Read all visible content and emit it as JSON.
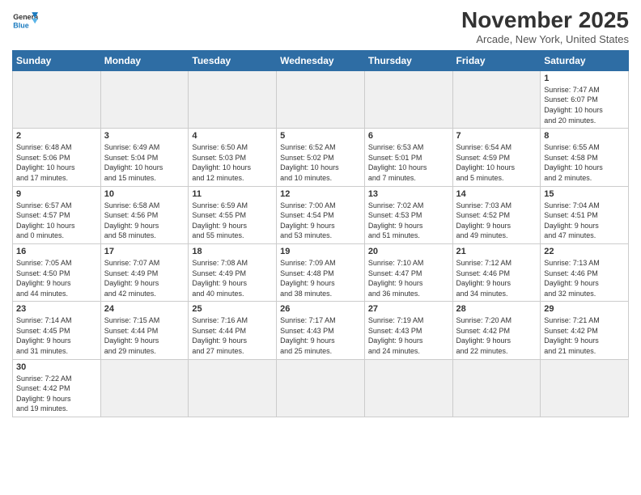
{
  "header": {
    "logo_general": "General",
    "logo_blue": "Blue",
    "month_title": "November 2025",
    "subtitle": "Arcade, New York, United States"
  },
  "weekdays": [
    "Sunday",
    "Monday",
    "Tuesday",
    "Wednesday",
    "Thursday",
    "Friday",
    "Saturday"
  ],
  "weeks": [
    [
      {
        "day": "",
        "info": ""
      },
      {
        "day": "",
        "info": ""
      },
      {
        "day": "",
        "info": ""
      },
      {
        "day": "",
        "info": ""
      },
      {
        "day": "",
        "info": ""
      },
      {
        "day": "",
        "info": ""
      },
      {
        "day": "1",
        "info": "Sunrise: 7:47 AM\nSunset: 6:07 PM\nDaylight: 10 hours\nand 20 minutes."
      }
    ],
    [
      {
        "day": "2",
        "info": "Sunrise: 6:48 AM\nSunset: 5:06 PM\nDaylight: 10 hours\nand 17 minutes."
      },
      {
        "day": "3",
        "info": "Sunrise: 6:49 AM\nSunset: 5:04 PM\nDaylight: 10 hours\nand 15 minutes."
      },
      {
        "day": "4",
        "info": "Sunrise: 6:50 AM\nSunset: 5:03 PM\nDaylight: 10 hours\nand 12 minutes."
      },
      {
        "day": "5",
        "info": "Sunrise: 6:52 AM\nSunset: 5:02 PM\nDaylight: 10 hours\nand 10 minutes."
      },
      {
        "day": "6",
        "info": "Sunrise: 6:53 AM\nSunset: 5:01 PM\nDaylight: 10 hours\nand 7 minutes."
      },
      {
        "day": "7",
        "info": "Sunrise: 6:54 AM\nSunset: 4:59 PM\nDaylight: 10 hours\nand 5 minutes."
      },
      {
        "day": "8",
        "info": "Sunrise: 6:55 AM\nSunset: 4:58 PM\nDaylight: 10 hours\nand 2 minutes."
      }
    ],
    [
      {
        "day": "9",
        "info": "Sunrise: 6:57 AM\nSunset: 4:57 PM\nDaylight: 10 hours\nand 0 minutes."
      },
      {
        "day": "10",
        "info": "Sunrise: 6:58 AM\nSunset: 4:56 PM\nDaylight: 9 hours\nand 58 minutes."
      },
      {
        "day": "11",
        "info": "Sunrise: 6:59 AM\nSunset: 4:55 PM\nDaylight: 9 hours\nand 55 minutes."
      },
      {
        "day": "12",
        "info": "Sunrise: 7:00 AM\nSunset: 4:54 PM\nDaylight: 9 hours\nand 53 minutes."
      },
      {
        "day": "13",
        "info": "Sunrise: 7:02 AM\nSunset: 4:53 PM\nDaylight: 9 hours\nand 51 minutes."
      },
      {
        "day": "14",
        "info": "Sunrise: 7:03 AM\nSunset: 4:52 PM\nDaylight: 9 hours\nand 49 minutes."
      },
      {
        "day": "15",
        "info": "Sunrise: 7:04 AM\nSunset: 4:51 PM\nDaylight: 9 hours\nand 47 minutes."
      }
    ],
    [
      {
        "day": "16",
        "info": "Sunrise: 7:05 AM\nSunset: 4:50 PM\nDaylight: 9 hours\nand 44 minutes."
      },
      {
        "day": "17",
        "info": "Sunrise: 7:07 AM\nSunset: 4:49 PM\nDaylight: 9 hours\nand 42 minutes."
      },
      {
        "day": "18",
        "info": "Sunrise: 7:08 AM\nSunset: 4:49 PM\nDaylight: 9 hours\nand 40 minutes."
      },
      {
        "day": "19",
        "info": "Sunrise: 7:09 AM\nSunset: 4:48 PM\nDaylight: 9 hours\nand 38 minutes."
      },
      {
        "day": "20",
        "info": "Sunrise: 7:10 AM\nSunset: 4:47 PM\nDaylight: 9 hours\nand 36 minutes."
      },
      {
        "day": "21",
        "info": "Sunrise: 7:12 AM\nSunset: 4:46 PM\nDaylight: 9 hours\nand 34 minutes."
      },
      {
        "day": "22",
        "info": "Sunrise: 7:13 AM\nSunset: 4:46 PM\nDaylight: 9 hours\nand 32 minutes."
      }
    ],
    [
      {
        "day": "23",
        "info": "Sunrise: 7:14 AM\nSunset: 4:45 PM\nDaylight: 9 hours\nand 31 minutes."
      },
      {
        "day": "24",
        "info": "Sunrise: 7:15 AM\nSunset: 4:44 PM\nDaylight: 9 hours\nand 29 minutes."
      },
      {
        "day": "25",
        "info": "Sunrise: 7:16 AM\nSunset: 4:44 PM\nDaylight: 9 hours\nand 27 minutes."
      },
      {
        "day": "26",
        "info": "Sunrise: 7:17 AM\nSunset: 4:43 PM\nDaylight: 9 hours\nand 25 minutes."
      },
      {
        "day": "27",
        "info": "Sunrise: 7:19 AM\nSunset: 4:43 PM\nDaylight: 9 hours\nand 24 minutes."
      },
      {
        "day": "28",
        "info": "Sunrise: 7:20 AM\nSunset: 4:42 PM\nDaylight: 9 hours\nand 22 minutes."
      },
      {
        "day": "29",
        "info": "Sunrise: 7:21 AM\nSunset: 4:42 PM\nDaylight: 9 hours\nand 21 minutes."
      }
    ],
    [
      {
        "day": "30",
        "info": "Sunrise: 7:22 AM\nSunset: 4:42 PM\nDaylight: 9 hours\nand 19 minutes."
      },
      {
        "day": "",
        "info": ""
      },
      {
        "day": "",
        "info": ""
      },
      {
        "day": "",
        "info": ""
      },
      {
        "day": "",
        "info": ""
      },
      {
        "day": "",
        "info": ""
      },
      {
        "day": "",
        "info": ""
      }
    ]
  ]
}
